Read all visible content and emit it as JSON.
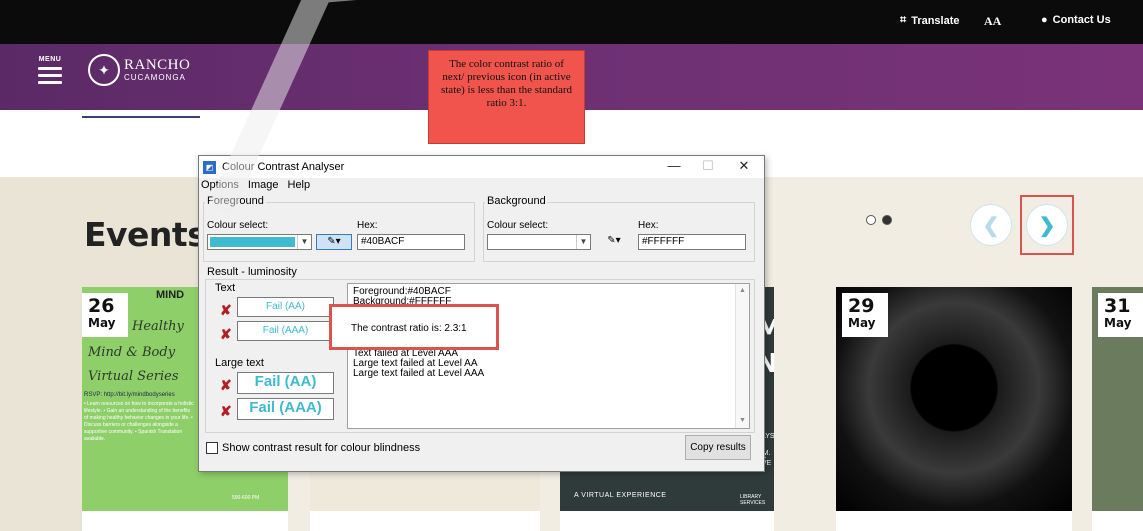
{
  "topbar": {
    "translate": "Translate",
    "font_size": "AA",
    "contact": "Contact Us"
  },
  "header": {
    "menu_label": "MENU",
    "logo_line1": "RANCHO",
    "logo_line2": "CUCAMONGA"
  },
  "callout": {
    "text": "The color contrast ratio of next/ previous icon (in active state) is less than the standard ratio 3:1."
  },
  "events": {
    "title": "Events",
    "carousel_dots": 2,
    "active_dot": 2,
    "cards": [
      {
        "day": "26",
        "month": "May",
        "mind_text": "MIND",
        "script1": "Healthy",
        "script2": "Mind & Body",
        "script3": "Virtual Series",
        "rsvp": "RSVP: http://bit.ly/mindbodyseries",
        "bullets": "• Learn resources on how to incorporate a holistic lifestyle. • Gain an understanding of the benefits of making healthy behavior changes in your life. • Discuss barriers or challenges alongside a supportive community. • Spanish Translation available.",
        "time": "500-600 PM"
      },
      {
        "day": "",
        "month": ""
      },
      {
        "big1": "ME",
        "big2": "NE",
        "small1": "DAYS AT",
        "small2": "00 A.M.",
        "small3": "OK LIVE",
        "footer": "A VIRTUAL EXPERIENCE",
        "library": "LIBRARY SERVICES"
      },
      {
        "day": "29",
        "month": "May"
      },
      {
        "day": "31",
        "month": "May"
      }
    ]
  },
  "cca": {
    "title": "Colour Contrast Analyser",
    "menu": [
      "Options",
      "Image",
      "Help"
    ],
    "foreground": {
      "group_label": "Foreground",
      "colour_select_label": "Colour select:",
      "hex_label": "Hex:",
      "hex_value": "#40BACF",
      "color": "#40BACF"
    },
    "background": {
      "group_label": "Background",
      "colour_select_label": "Colour select:",
      "hex_label": "Hex:",
      "hex_value": "#FFFFFF",
      "color": "#FFFFFF"
    },
    "result_label": "Result - luminosity",
    "text_label": "Text",
    "large_text_label": "Large text",
    "text_aa": "Fail (AA)",
    "text_aaa": "Fail (AAA)",
    "large_aa": "Fail (AA)",
    "large_aaa": "Fail (AAA)",
    "results_lines": [
      "Foreground:#40BACF",
      "Background:#FFFFFF",
      "",
      "The contrast ratio is: 2.3:1",
      "",
      "Text failed at Level AA",
      "Text failed at Level AAA",
      "Large text failed at Level AA",
      "Large text failed at Level AAA"
    ],
    "colour_blindness_label": "Show contrast result for colour blindness",
    "copy_button": "Copy results"
  }
}
